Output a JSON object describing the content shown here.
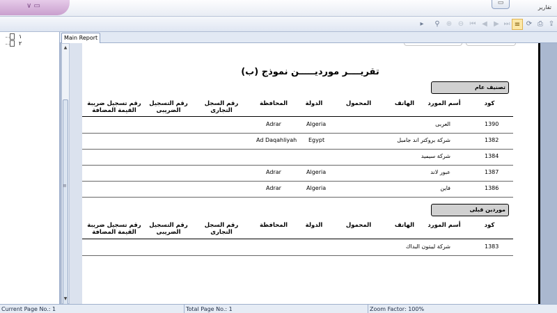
{
  "window": {
    "title": "تقارير"
  },
  "tree": {
    "items": [
      {
        "label": "١"
      },
      {
        "label": "٢"
      }
    ]
  },
  "tab": {
    "label": "Main Report"
  },
  "report": {
    "title": "تقريــــر مورديـــــن نموذج (ب)",
    "columns": [
      {
        "key": "code",
        "label": "كود"
      },
      {
        "key": "name",
        "label": "أسم المورد"
      },
      {
        "key": "phone",
        "label": "الهاتف"
      },
      {
        "key": "mobile",
        "label": "المحمول"
      },
      {
        "key": "country",
        "label": "الدولة"
      },
      {
        "key": "governorate",
        "label": "المحافظة"
      },
      {
        "key": "commercial",
        "label": "رقم السجل التجارى"
      },
      {
        "key": "tax",
        "label": "رقم التسجيل الضريبى"
      },
      {
        "key": "vat",
        "label": "رقم تسجيل ضريبة القيمة المضافة"
      }
    ],
    "groups": [
      {
        "name": "تصنيف عام",
        "rows": [
          {
            "code": "1390",
            "name": "العربى",
            "country": "Algeria",
            "governorate": "Adrar"
          },
          {
            "code": "1382",
            "name": "شركة بروكتر اند جامبل",
            "country": "Egypt",
            "governorate": "Ad Daqahliyah"
          },
          {
            "code": "1384",
            "name": "شركة سيميد",
            "country": "",
            "governorate": ""
          },
          {
            "code": "1387",
            "name": "عبور لاند",
            "country": "Algeria",
            "governorate": "Adrar"
          },
          {
            "code": "1386",
            "name": "فاين",
            "country": "Algeria",
            "governorate": "Adrar"
          }
        ]
      },
      {
        "name": "موردين قبلى",
        "rows": [
          {
            "code": "1383",
            "name": "شركة ليبتون البداك",
            "country": "",
            "governorate": ""
          }
        ]
      }
    ]
  },
  "status": {
    "current_page": "Current Page No.: 1",
    "total_page": "Total Page No.: 1",
    "zoom": "Zoom Factor: 100%"
  }
}
